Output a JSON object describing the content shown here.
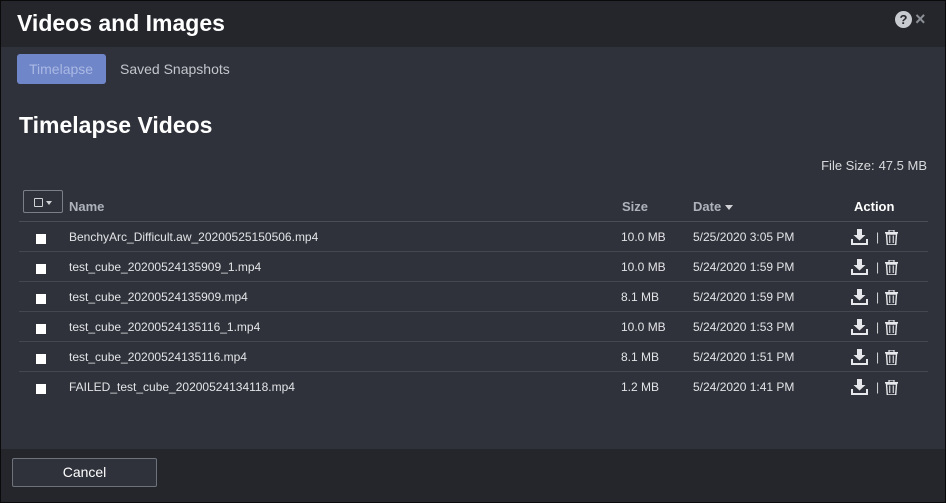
{
  "dialog": {
    "title": "Videos and Images",
    "help_icon": "help-circle-icon",
    "help_glyph": "?",
    "close_icon": "close-icon",
    "close_glyph": "×"
  },
  "tabs": [
    {
      "label": "Timelapse",
      "active": true
    },
    {
      "label": "Saved Snapshots",
      "active": false
    }
  ],
  "section": {
    "title": "Timelapse Videos",
    "file_size_label": "File Size:",
    "file_size_value": "47.5 MB"
  },
  "table": {
    "columns": {
      "name": "Name",
      "size": "Size",
      "date": "Date",
      "action": "Action"
    },
    "rows": [
      {
        "name": "BenchyArc_Difficult.aw_20200525150506.mp4",
        "size": "10.0 MB",
        "date": "5/25/2020 3:05 PM"
      },
      {
        "name": "test_cube_20200524135909_1.mp4",
        "size": "10.0 MB",
        "date": "5/24/2020 1:59 PM"
      },
      {
        "name": "test_cube_20200524135909.mp4",
        "size": "8.1 MB",
        "date": "5/24/2020 1:59 PM"
      },
      {
        "name": "test_cube_20200524135116_1.mp4",
        "size": "10.0 MB",
        "date": "5/24/2020 1:53 PM"
      },
      {
        "name": "test_cube_20200524135116.mp4",
        "size": "8.1 MB",
        "date": "5/24/2020 1:51 PM"
      },
      {
        "name": "FAILED_test_cube_20200524134118.mp4",
        "size": "1.2 MB",
        "date": "5/24/2020 1:41 PM"
      }
    ],
    "action_separator": "|",
    "action_icons": [
      "download-icon",
      "trash-icon"
    ]
  },
  "footer": {
    "cancel_label": "Cancel"
  },
  "colors": {
    "accent": "#6f86c9",
    "panel": "#2f323a",
    "header": "#24262c"
  }
}
